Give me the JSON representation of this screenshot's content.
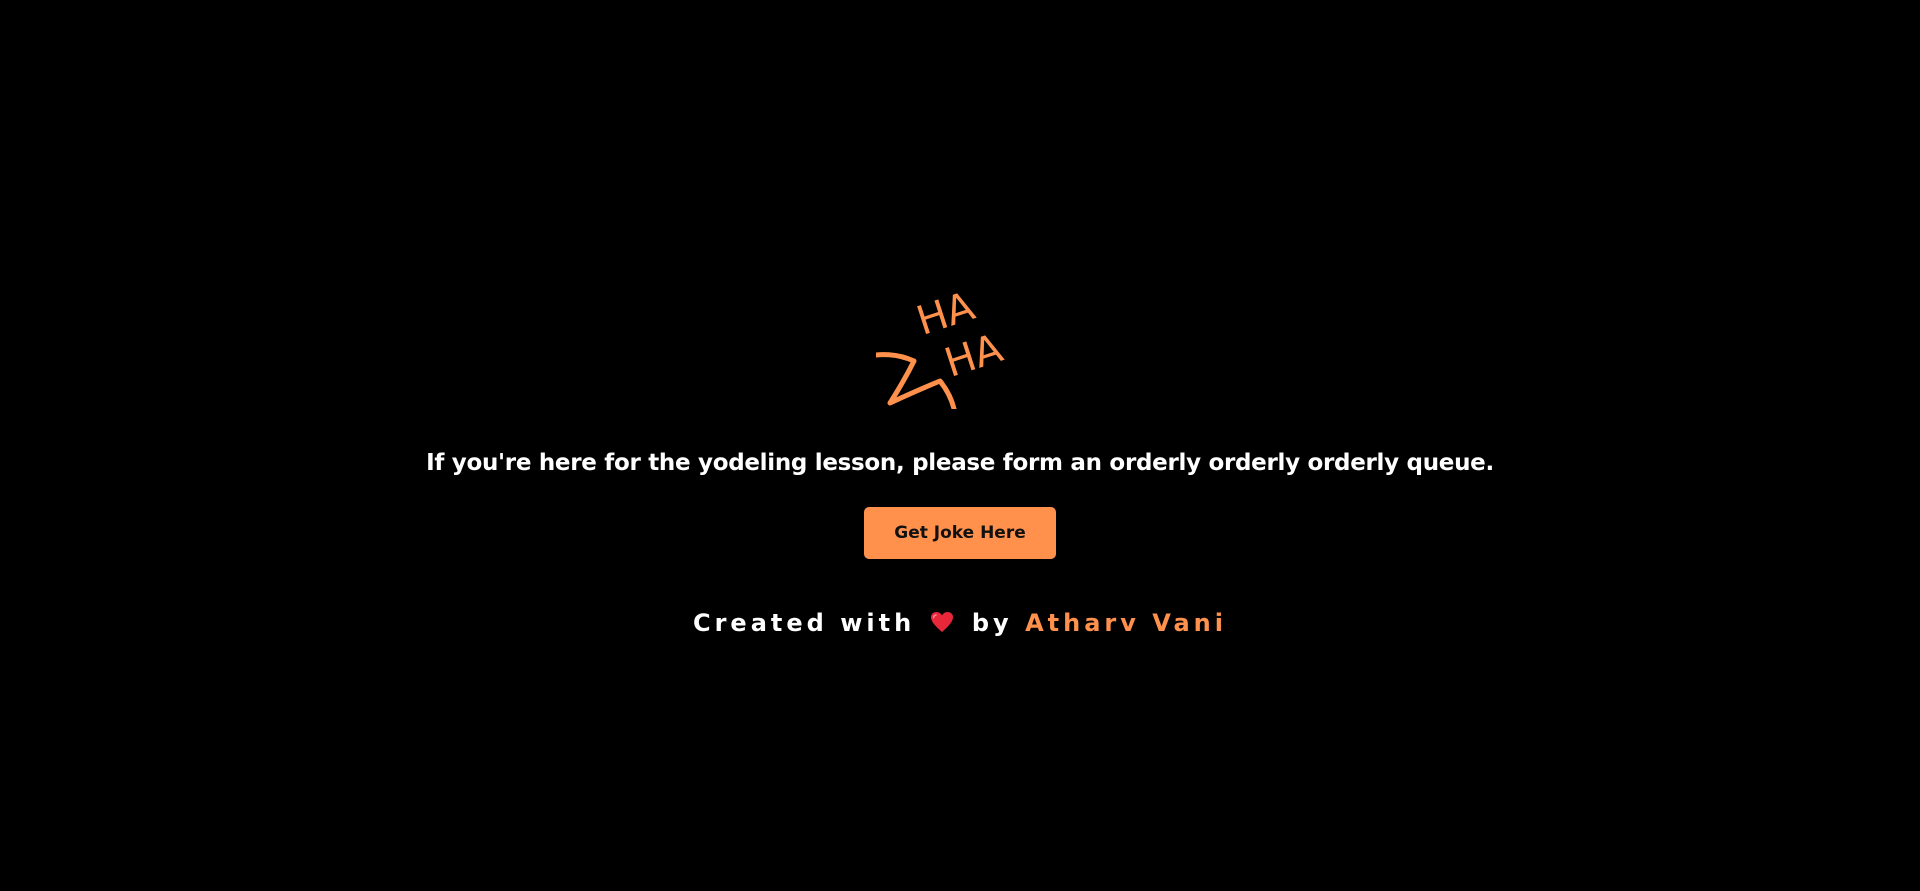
{
  "colors": {
    "background": "#000000",
    "accent": "#ff914d",
    "text": "#ffffff",
    "heart": "#e8283a"
  },
  "logo": {
    "icon": "haha-speech-bubble-icon",
    "line1": "HA",
    "line2": "HA"
  },
  "joke": {
    "text": "If you're here for the yodeling lesson, please form an orderly orderly orderly queue."
  },
  "button": {
    "label": "Get Joke Here"
  },
  "footer": {
    "prefix": "Created with",
    "heart_icon": "heart-icon",
    "by": "by",
    "author": "Atharv Vani"
  }
}
